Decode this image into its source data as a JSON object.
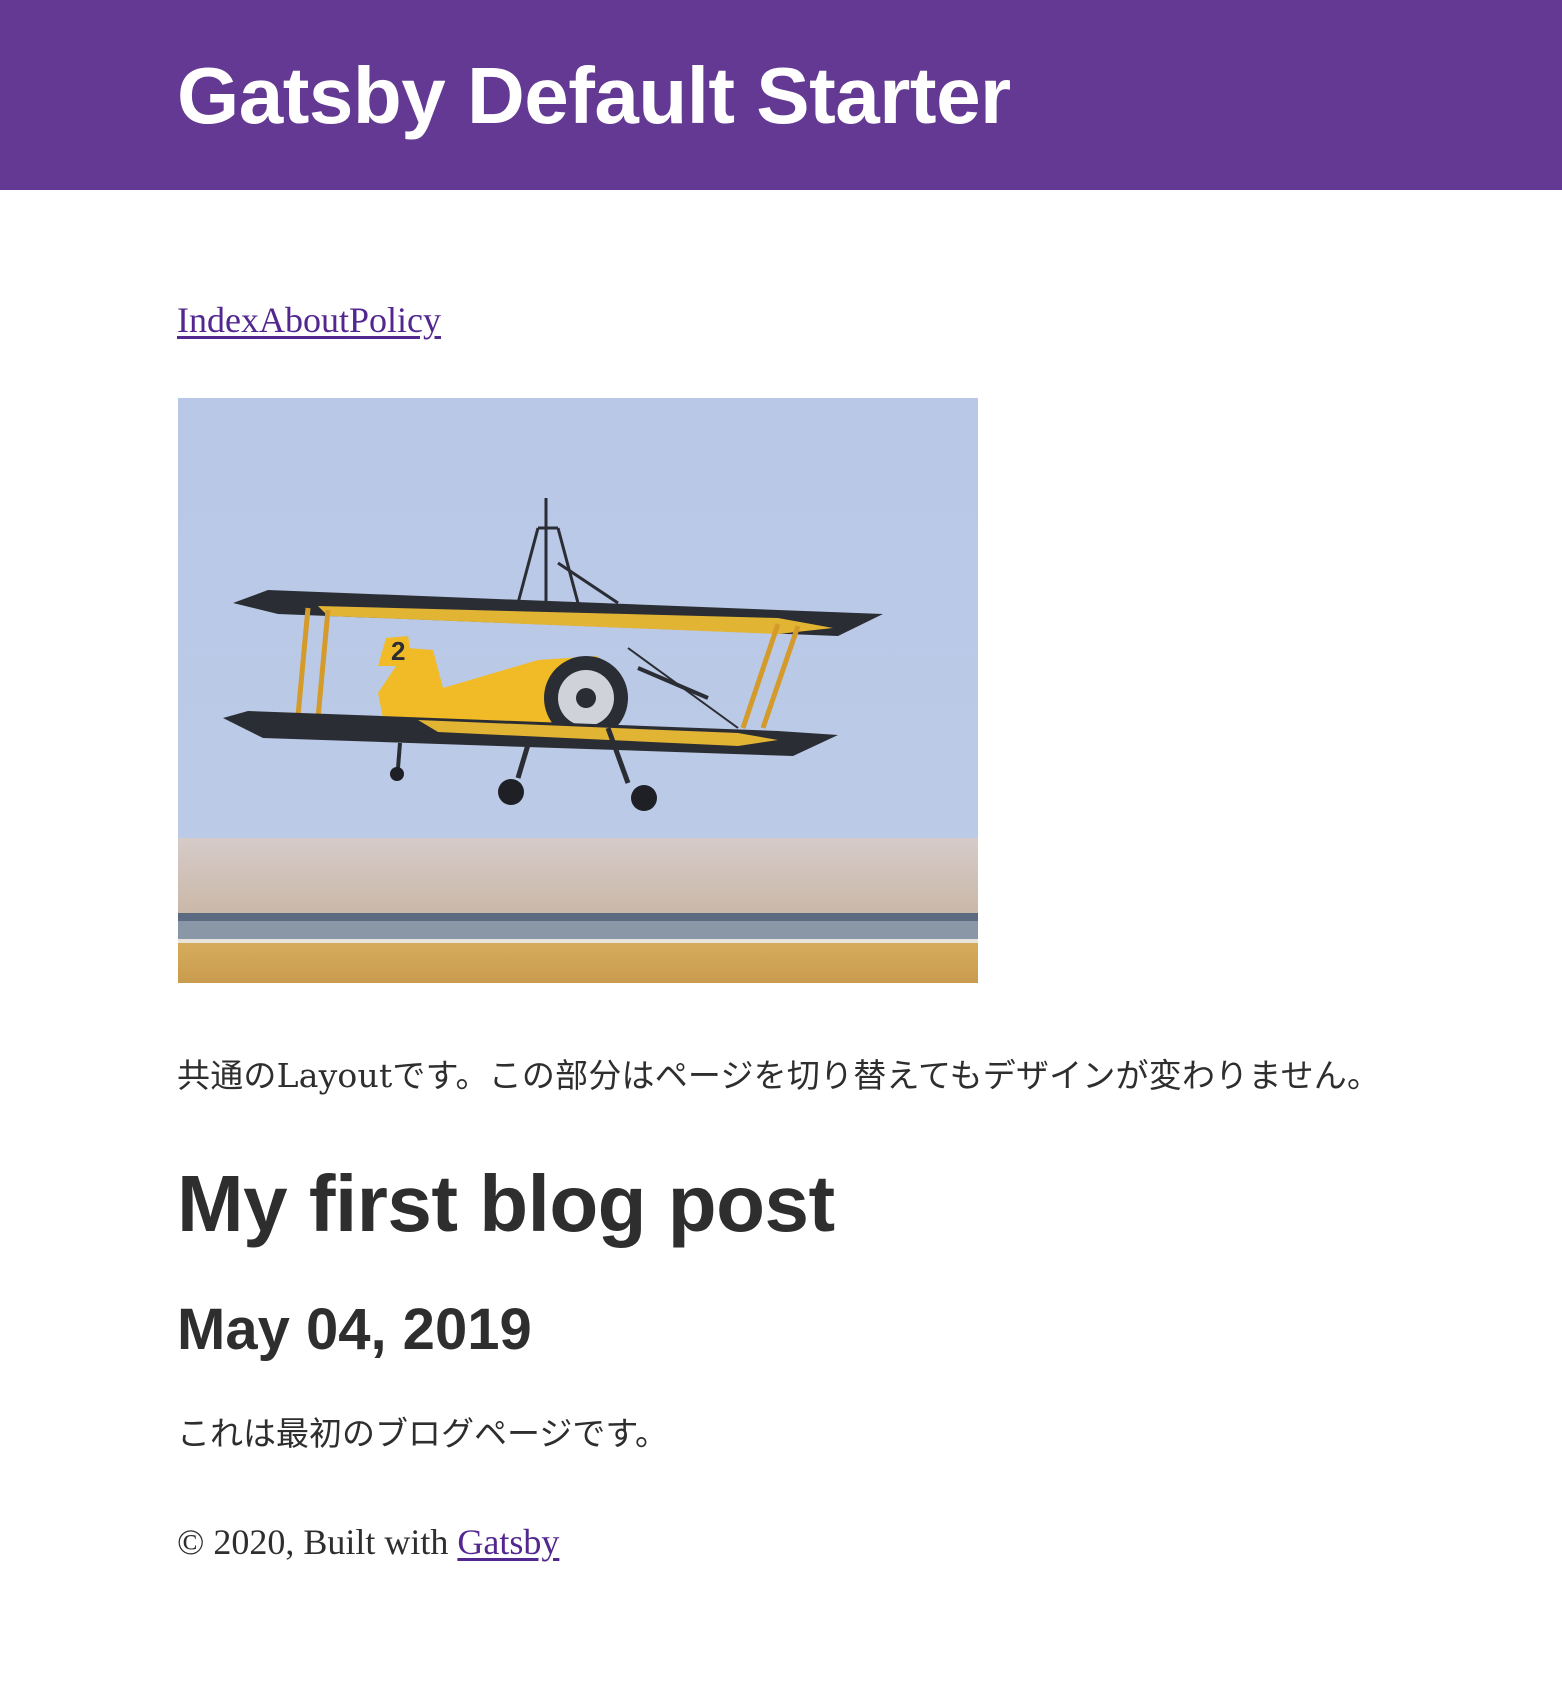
{
  "header": {
    "site_title": "Gatsby Default Starter",
    "background_color": "#633993"
  },
  "nav": {
    "links": [
      {
        "label": "Index"
      },
      {
        "label": "About"
      },
      {
        "label": "Policy"
      }
    ],
    "link_color": "#52278f"
  },
  "hero_image": {
    "description_icon": "biplane-photo"
  },
  "layout_note": "共通のLayoutです。この部分はページを切り替えてもデザインが変わりません。",
  "post": {
    "title": "My first blog post",
    "date": "May 04, 2019",
    "body": "これは最初のブログページです。"
  },
  "footer": {
    "prefix": "© 2020, Built with ",
    "link_label": "Gatsby"
  }
}
